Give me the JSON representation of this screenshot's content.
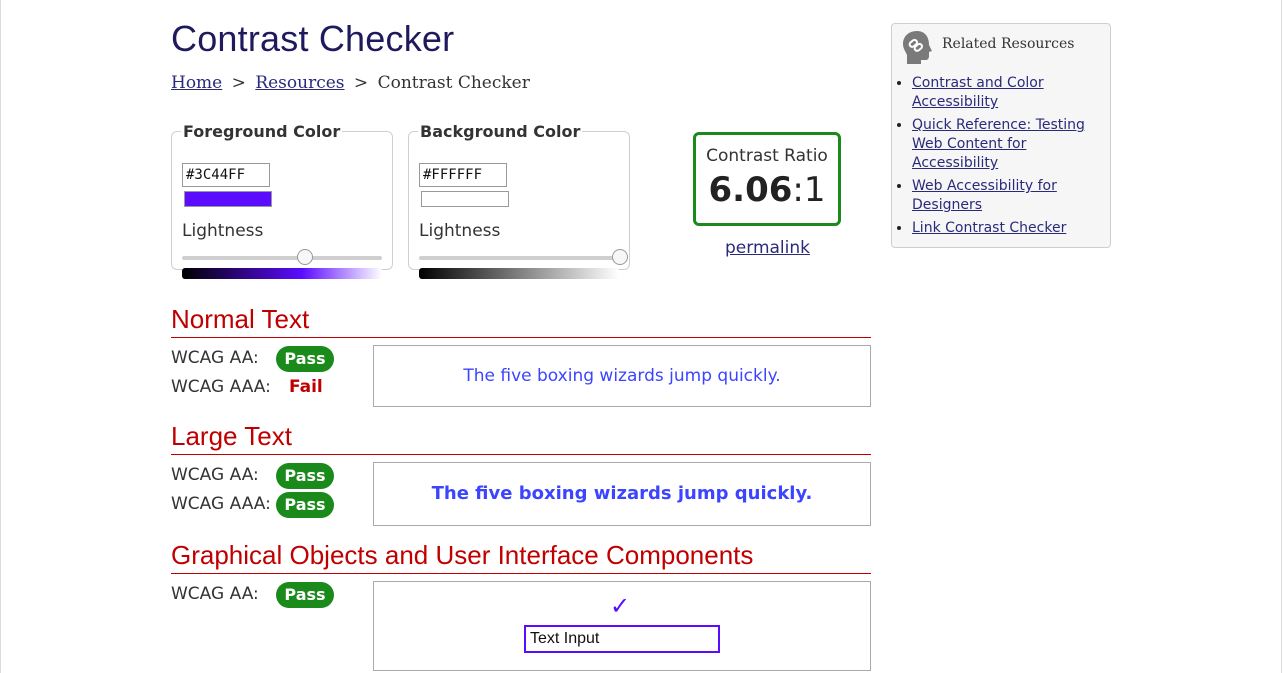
{
  "page": {
    "title": "Contrast Checker"
  },
  "breadcrumb": {
    "home": "Home",
    "resources": "Resources",
    "current": "Contrast Checker",
    "separator": ">"
  },
  "foreground": {
    "legend": "Foreground Color",
    "hex": "#3C44FF",
    "lightness_label": "Lightness",
    "swatch_color": "#5b0cff",
    "lightness": 0.61
  },
  "background": {
    "legend": "Background Color",
    "hex": "#FFFFFF",
    "lightness_label": "Lightness",
    "swatch_color": "#ffffff",
    "lightness": 1.0
  },
  "ratio": {
    "label": "Contrast Ratio",
    "value": "6.06",
    "suffix": ":1",
    "permalink": "permalink"
  },
  "normal_text": {
    "heading": "Normal Text",
    "aa_label": "WCAG AA:",
    "aa_result": "Pass",
    "aaa_label": "WCAG AAA:",
    "aaa_result": "Fail",
    "sample": "The five boxing wizards jump quickly."
  },
  "large_text": {
    "heading": "Large Text",
    "aa_label": "WCAG AA:",
    "aa_result": "Pass",
    "aaa_label": "WCAG AAA:",
    "aaa_result": "Pass",
    "sample": "The five boxing wizards jump quickly."
  },
  "graphical": {
    "heading": "Graphical Objects and User Interface Components",
    "aa_label": "WCAG AA:",
    "aa_result": "Pass",
    "checkmark": "✓",
    "input_value": "Text Input"
  },
  "related": {
    "title": "Related Resources",
    "links": [
      "Contrast and Color Accessibility",
      "Quick Reference: Testing Web Content for Accessibility",
      "Web Accessibility for Designers",
      "Link Contrast Checker"
    ]
  },
  "colors": {
    "pass": "#1a8a1a",
    "fail": "#c00000",
    "heading": "#1e1a5c",
    "sample_text": "#3c44ff"
  }
}
